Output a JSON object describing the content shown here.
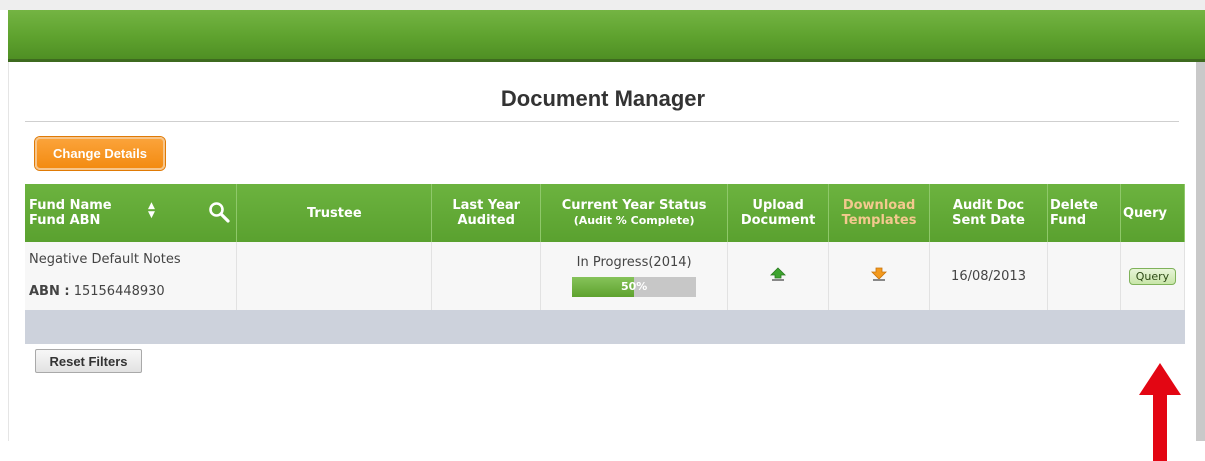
{
  "page": {
    "title": "Document Manager",
    "change_details_label": "Change Details",
    "reset_filters_label": "Reset Filters"
  },
  "table": {
    "headers": {
      "fund_name": "Fund Name",
      "fund_abn": "Fund ABN",
      "trustee": "Trustee",
      "last_year_line1": "Last Year",
      "last_year_line2": "Audited",
      "status_line1": "Current Year Status",
      "status_line2": "(Audit % Complete)",
      "upload_line1": "Upload",
      "upload_line2": "Document",
      "download_line1": "Download",
      "download_line2": "Templates",
      "audit_line1": "Audit Doc",
      "audit_line2": "Sent Date",
      "delete_line1": "Delete",
      "delete_line2": "Fund",
      "query": "Query"
    },
    "rows": [
      {
        "fund_name": "Negative Default Notes",
        "abn_label": "ABN :",
        "abn_value": "15156448930",
        "trustee": "",
        "last_year_audited": "",
        "status": "In Progress(2014)",
        "progress_percent": 50,
        "progress_label": "50%",
        "audit_doc_sent_date": "16/08/2013",
        "delete_fund": "",
        "query_label": "Query"
      }
    ]
  },
  "icons": {
    "sort": "sort-arrows-icon",
    "search": "search-icon",
    "upload": "upload-arrow-icon",
    "download": "download-arrow-icon"
  },
  "colors": {
    "header_green": "#5ea22e",
    "accent_orange": "#f38b11",
    "annotation_red": "#e30613"
  }
}
